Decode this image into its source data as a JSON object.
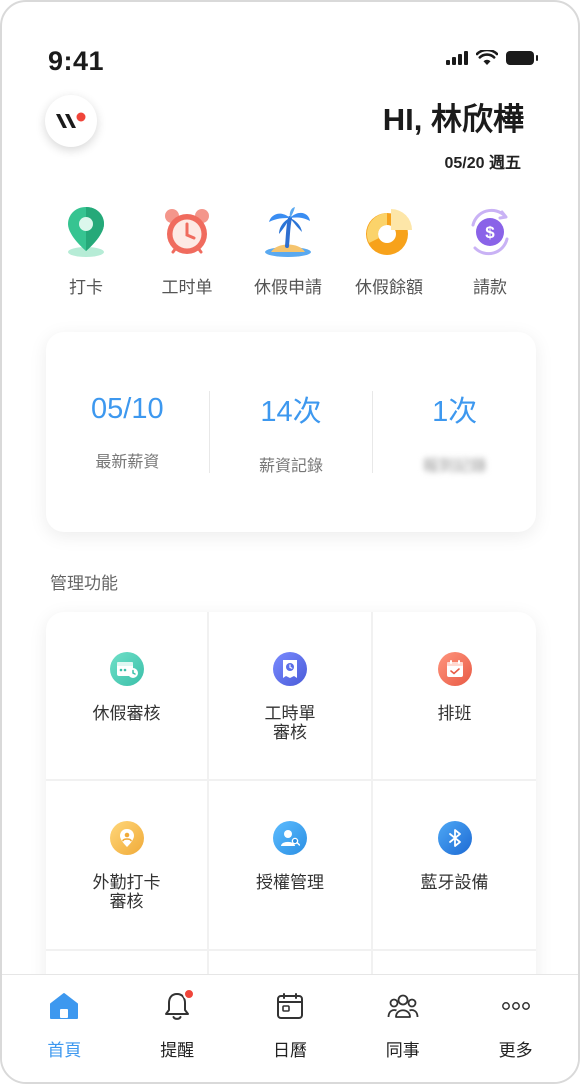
{
  "status_bar": {
    "time": "9:41"
  },
  "header": {
    "greeting": "HI, 林欣樺",
    "date": "05/20 週五"
  },
  "quick_actions": [
    {
      "label": "打卡",
      "icon": "location-pin-icon"
    },
    {
      "label": "工时单",
      "icon": "alarm-clock-icon"
    },
    {
      "label": "休假申請",
      "icon": "palm-tree-icon"
    },
    {
      "label": "休假餘額",
      "icon": "pie-chart-icon"
    },
    {
      "label": "請款",
      "icon": "dollar-coin-icon"
    }
  ],
  "stats": [
    {
      "value": "05/10",
      "label": "最新薪資"
    },
    {
      "value": "14次",
      "label": "薪資記錄"
    },
    {
      "value": "1次",
      "label": "報到記錄"
    }
  ],
  "section": {
    "manage_title": "管理功能"
  },
  "manage_items": [
    {
      "label": "休假審核",
      "icon": "calendar-check-icon",
      "color": "#4ecdb8"
    },
    {
      "label": "工時單\n審核",
      "icon": "timesheet-clock-icon",
      "color": "#5b6ee8"
    },
    {
      "label": "排班",
      "icon": "schedule-calendar-icon",
      "color": "#f2735b"
    },
    {
      "label": "外勤打卡\n審核",
      "icon": "field-checkin-icon",
      "color": "#f7c25a"
    },
    {
      "label": "授權管理",
      "icon": "user-key-icon",
      "color": "#3aa3ec"
    },
    {
      "label": "藍牙設備",
      "icon": "bluetooth-icon",
      "color": "#2f7fe0"
    },
    {
      "label": "",
      "icon": "",
      "color": ""
    },
    {
      "label": "",
      "icon": "",
      "color": ""
    },
    {
      "label": "",
      "icon": "",
      "color": ""
    }
  ],
  "tabs": [
    {
      "label": "首頁",
      "icon": "home-icon",
      "active": true
    },
    {
      "label": "提醒",
      "icon": "bell-icon",
      "active": false
    },
    {
      "label": "日曆",
      "icon": "calendar-icon",
      "active": false
    },
    {
      "label": "同事",
      "icon": "colleagues-icon",
      "active": false
    },
    {
      "label": "更多",
      "icon": "more-icon",
      "active": false
    }
  ],
  "colors": {
    "accent": "#3d98ef",
    "notification": "#f0453a"
  }
}
